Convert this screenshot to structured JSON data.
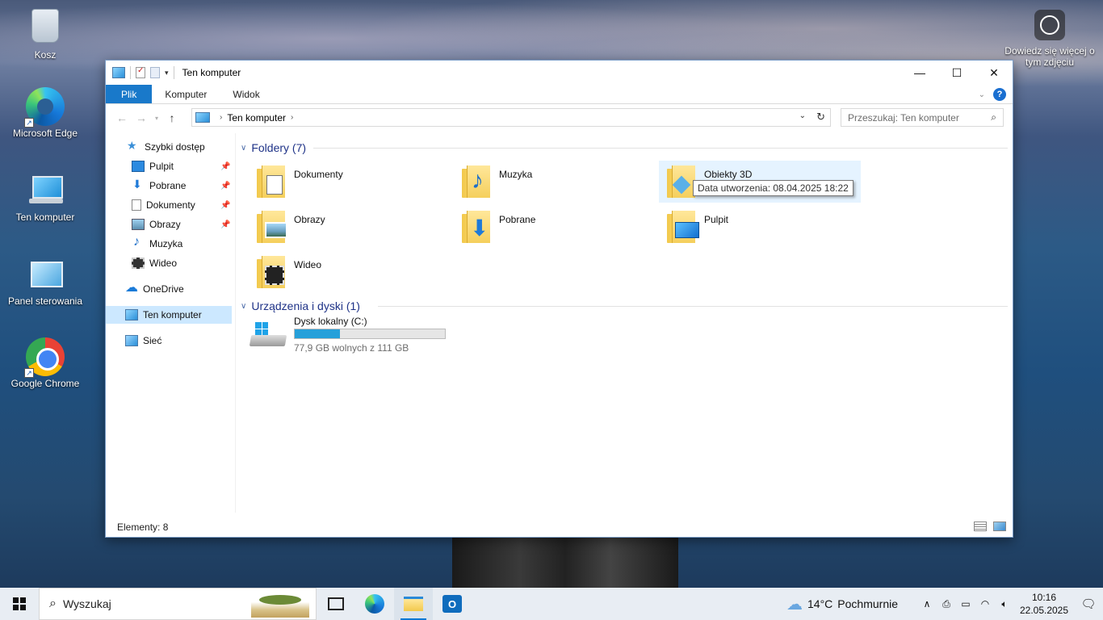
{
  "desktop": {
    "icons": [
      {
        "label": "Kosz"
      },
      {
        "label": "Microsoft Edge"
      },
      {
        "label": "Ten komputer"
      },
      {
        "label": "Panel sterowania"
      },
      {
        "label": "Google Chrome"
      }
    ],
    "learn_more": {
      "line1": "Dowiedz się więcej o",
      "line2": "tym zdjęciu"
    }
  },
  "window": {
    "title": "Ten komputer",
    "controls": {
      "minimize": "—",
      "maximize": "☐",
      "close": "✕"
    },
    "ribbon": {
      "tabs": [
        {
          "label": "Plik"
        },
        {
          "label": "Komputer"
        },
        {
          "label": "Widok"
        }
      ]
    },
    "address": {
      "path": "Ten komputer"
    },
    "search": {
      "placeholder": "Przeszukaj: Ten komputer"
    },
    "nav_pane": {
      "quick_access": "Szybki dostęp",
      "quick_items": [
        {
          "label": "Pulpit"
        },
        {
          "label": "Pobrane"
        },
        {
          "label": "Dokumenty"
        },
        {
          "label": "Obrazy"
        },
        {
          "label": "Muzyka"
        },
        {
          "label": "Wideo"
        }
      ],
      "onedrive": "OneDrive",
      "this_pc": "Ten komputer",
      "network": "Sieć"
    },
    "folders_header": "Foldery (7)",
    "folders": [
      {
        "name": "Dokumenty"
      },
      {
        "name": "Muzyka"
      },
      {
        "name": "Obiekty 3D"
      },
      {
        "name": "Obrazy"
      },
      {
        "name": "Pobrane"
      },
      {
        "name": "Pulpit"
      },
      {
        "name": "Wideo"
      }
    ],
    "tooltip": "Data utworzenia: 08.04.2025 18:22",
    "devices_header": "Urządzenia i dyski (1)",
    "drive": {
      "name": "Dysk lokalny (C:)",
      "free_text": "77,9 GB wolnych z 111 GB",
      "used_fraction": 0.3
    },
    "status": "Elementy: 8"
  },
  "taskbar": {
    "search_placeholder": "Wyszukaj",
    "weather": {
      "temp": "14°C",
      "condition": "Pochmurnie"
    },
    "clock": {
      "time": "10:16",
      "date": "22.05.2025"
    }
  },
  "colors": {
    "accent": "#1979ca",
    "selection": "#cce8ff",
    "hover": "#e5f3ff",
    "drive_bar": "#26a0da",
    "group_header": "#1e3287"
  }
}
